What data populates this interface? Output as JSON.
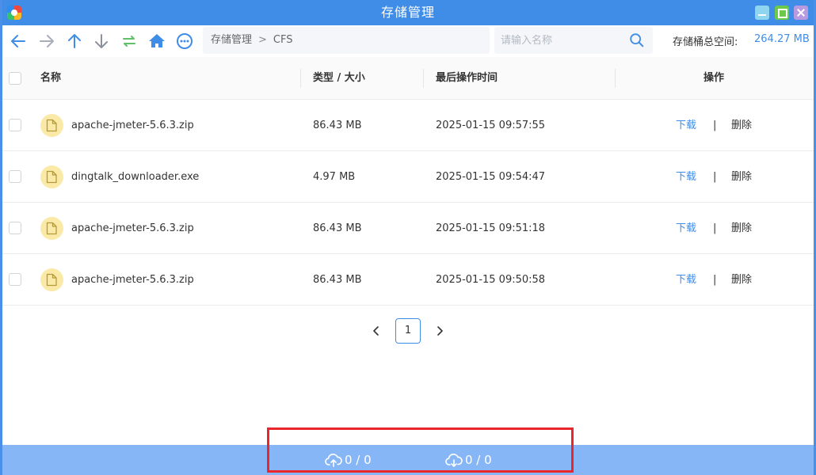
{
  "window": {
    "title": "存储管理"
  },
  "toolbar": {
    "icons": [
      "back-arrow-icon",
      "forward-arrow-icon",
      "upload-arrow-icon",
      "download-arrow-icon",
      "refresh-icon",
      "home-icon",
      "more-icon"
    ]
  },
  "breadcrumb": {
    "root": "存储管理",
    "separator": ">",
    "current": "CFS"
  },
  "search": {
    "placeholder": "请输入名称",
    "value": ""
  },
  "storage": {
    "label": "存储桶总空间:",
    "value": "264.27 MB"
  },
  "table": {
    "columns": {
      "name": "名称",
      "type_size": "类型 / 大小",
      "modified": "最后操作时间",
      "actions": "操作"
    },
    "rows": [
      {
        "name": "apache-jmeter-5.6.3.zip",
        "size": "86.43 MB",
        "time": "2025-01-15 09:57:55",
        "download": "下载",
        "sep": "|",
        "delete": "删除"
      },
      {
        "name": "dingtalk_downloader.exe",
        "size": "4.97 MB",
        "time": "2025-01-15 09:54:47",
        "download": "下载",
        "sep": "|",
        "delete": "删除"
      },
      {
        "name": "apache-jmeter-5.6.3.zip",
        "size": "86.43 MB",
        "time": "2025-01-15 09:51:18",
        "download": "下载",
        "sep": "|",
        "delete": "删除"
      },
      {
        "name": "apache-jmeter-5.6.3.zip",
        "size": "86.43 MB",
        "time": "2025-01-15 09:50:58",
        "download": "下载",
        "sep": "|",
        "delete": "删除"
      }
    ]
  },
  "pagination": {
    "current_page": "1"
  },
  "transfers": {
    "upload": "0 / 0",
    "download": "0 / 0"
  },
  "colors": {
    "accent": "#3f8de6",
    "title_bar": "#3f8de6",
    "bottom_bar": "#86b6f6",
    "file_icon_bg": "#fbe9a7",
    "highlight": "#e8262b"
  }
}
